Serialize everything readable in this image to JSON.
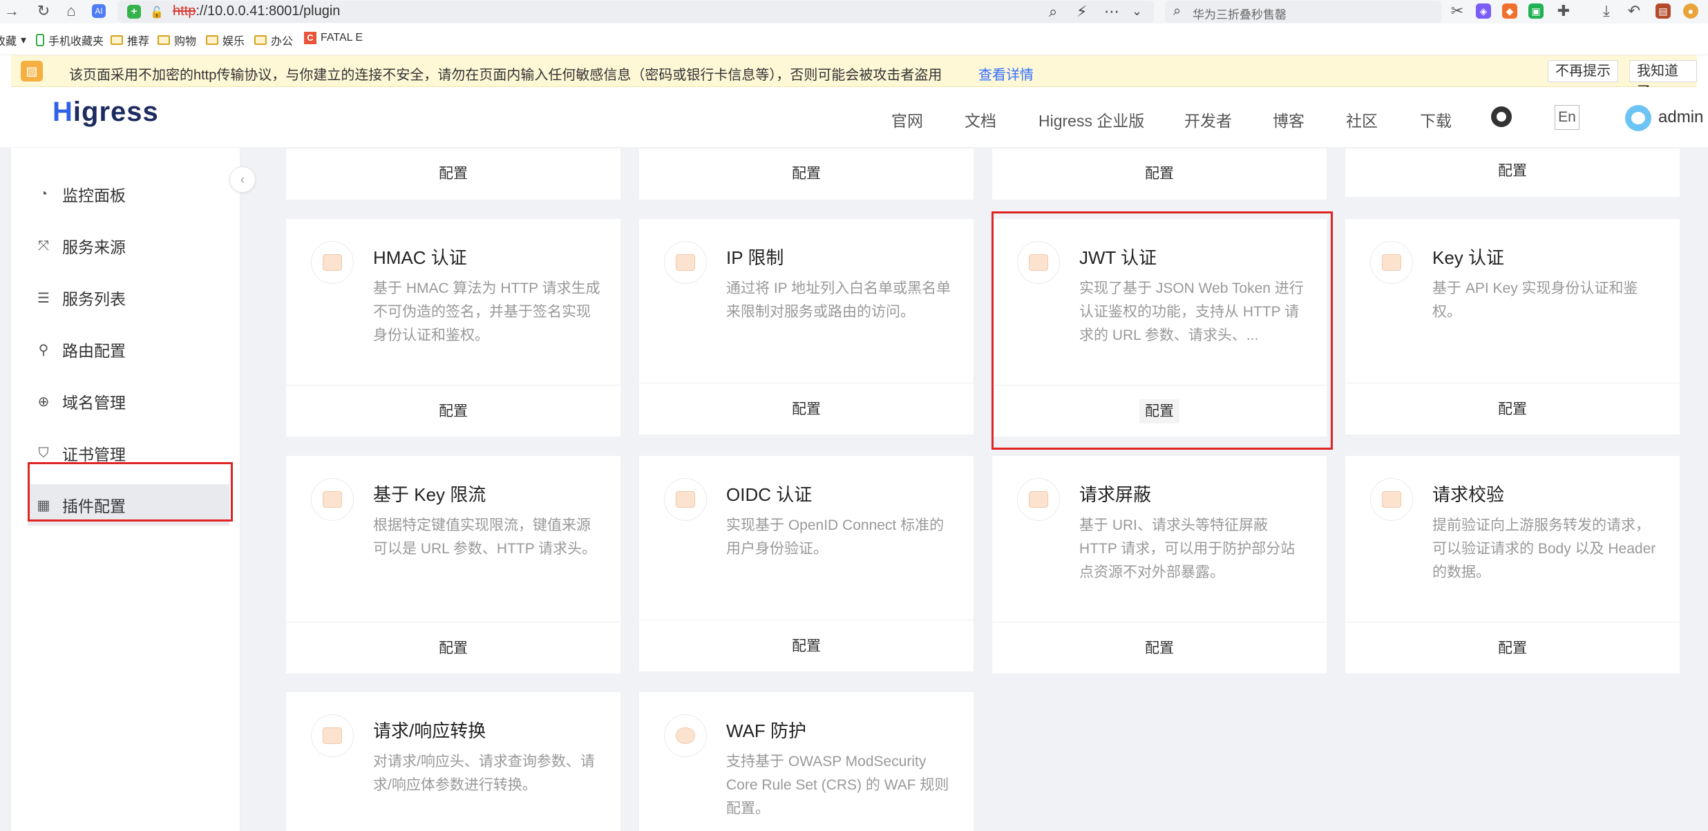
{
  "browser": {
    "url_protocol": "http",
    "url_rest": "://10.0.0.41:8001/plugin",
    "search_placeholder": "华为三折叠秒售罄",
    "bookmarks": [
      "收藏",
      "手机收藏夹",
      "推荐",
      "购物",
      "娱乐",
      "办公",
      "FATAL E"
    ],
    "warning_text": "该页面采用不加密的http传输协议，与你建立的连接不安全，请勿在页面内输入任何敏感信息（密码或银行卡信息等），否则可能会被攻击者盗用",
    "warning_link": "查看详情",
    "warning_btn_dismiss": "不再提示",
    "warning_btn_ok": "我知道了"
  },
  "header": {
    "logo_h": "H",
    "logo_rest": "igress",
    "nav": [
      "官网",
      "文档",
      "Higress 企业版",
      "开发者",
      "博客",
      "社区",
      "下载"
    ],
    "lang": "En",
    "user": "admin"
  },
  "sidebar": {
    "items": [
      {
        "label": "监控面板",
        "icon": "dashboard-icon"
      },
      {
        "label": "服务来源",
        "icon": "service-source-icon"
      },
      {
        "label": "服务列表",
        "icon": "list-icon"
      },
      {
        "label": "路由配置",
        "icon": "route-icon"
      },
      {
        "label": "域名管理",
        "icon": "globe-icon"
      },
      {
        "label": "证书管理",
        "icon": "shield-icon"
      },
      {
        "label": "插件配置",
        "icon": "plugin-grid-icon"
      }
    ],
    "active_index": 6
  },
  "plugins": {
    "config_label": "配置",
    "cards": [
      {
        "title": "HMAC 认证",
        "desc": "基于 HMAC 算法为 HTTP 请求生成不可伪造的签名，并基于签名实现身份认证和鉴权。"
      },
      {
        "title": "IP 限制",
        "desc": "通过将 IP 地址列入白名单或黑名单来限制对服务或路由的访问。"
      },
      {
        "title": "JWT 认证",
        "desc": "实现了基于 JSON Web Token 进行认证鉴权的功能，支持从 HTTP 请求的 URL 参数、请求头、..."
      },
      {
        "title": "Key 认证",
        "desc": "基于 API Key 实现身份认证和鉴权。"
      },
      {
        "title": "基于 Key 限流",
        "desc": "根据特定键值实现限流，键值来源可以是 URL 参数、HTTP 请求头。"
      },
      {
        "title": "OIDC 认证",
        "desc": "实现基于 OpenID Connect 标准的用户身份验证。"
      },
      {
        "title": "请求屏蔽",
        "desc": "基于 URI、请求头等特征屏蔽 HTTP 请求，可以用于防护部分站点资源不对外部暴露。"
      },
      {
        "title": "请求校验",
        "desc": "提前验证向上游服务转发的请求，可以验证请求的 Body 以及 Header 的数据。"
      },
      {
        "title": "请求/响应转换",
        "desc": "对请求/响应头、请求查询参数、请求/响应体参数进行转换。"
      },
      {
        "title": "WAF 防护",
        "desc": "支持基于 OWASP ModSecurity Core Rule Set (CRS) 的 WAF 规则配置。"
      }
    ]
  },
  "colors": {
    "accent": "#2f62e8",
    "highlight_border": "#e02424",
    "warning_bg": "#fff8d6"
  }
}
